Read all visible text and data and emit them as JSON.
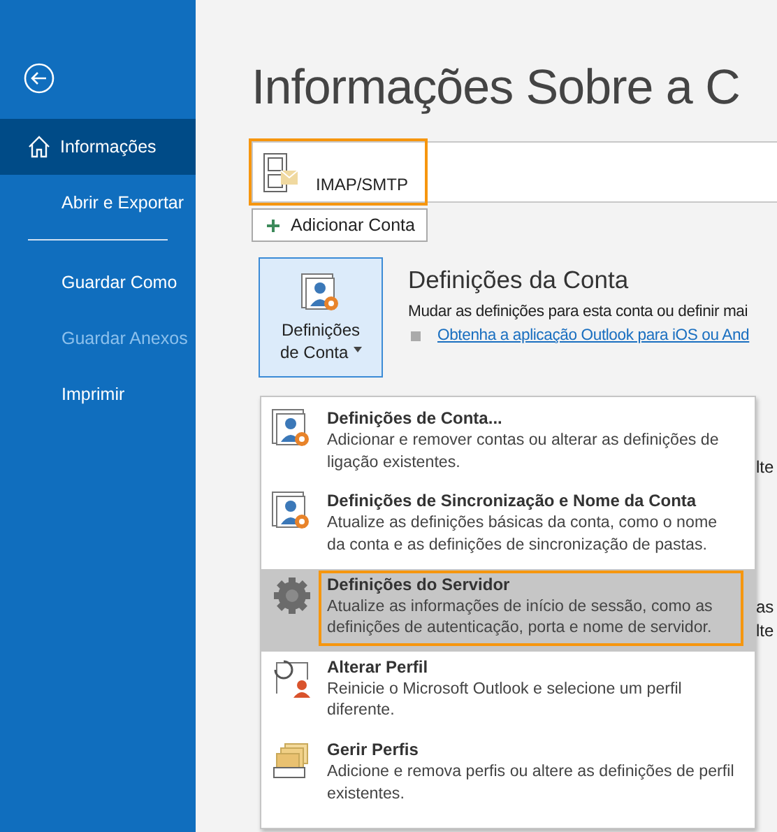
{
  "sidebar": {
    "items": [
      {
        "label": "Informações",
        "kind": "home",
        "selected": true,
        "disabled": false
      },
      {
        "label": "Abrir e Exportar",
        "kind": "plain",
        "selected": false,
        "disabled": false
      },
      {
        "kind": "divider"
      },
      {
        "label": "Guardar Como",
        "kind": "plain",
        "selected": false,
        "disabled": false
      },
      {
        "label": "Guardar Anexos",
        "kind": "plain",
        "selected": false,
        "disabled": true
      },
      {
        "label": "Imprimir",
        "kind": "plain",
        "selected": false,
        "disabled": false
      }
    ]
  },
  "page_title": "Informações Sobre a C",
  "account": {
    "label": "IMAP/SMTP",
    "highlighted": true
  },
  "add_account_button": "Adicionar Conta",
  "account_settings": {
    "button_label_line1": "Definições",
    "button_label_line2": "de Conta",
    "heading": "Definições da Conta",
    "description": "Mudar as definições para esta conta ou definir mai",
    "link": "Obtenha a aplicação Outlook para iOS ou And"
  },
  "background_fragments": [
    "lte",
    "as",
    "lte"
  ],
  "menu": {
    "items": [
      {
        "kind": "person-gear",
        "title": "Definições de Conta...",
        "description": "Adicionar e remover contas ou alterar as definições de ligação existentes.",
        "selected": false,
        "highlighted": false
      },
      {
        "kind": "person-gear",
        "title": "Definições de Sincronização e Nome da Conta",
        "description": "Atualize as definições básicas da conta, como o nome da conta e as definições de sincronização de pastas.",
        "selected": false,
        "highlighted": false
      },
      {
        "kind": "gear",
        "title": "Definições do Servidor",
        "description": "Atualize as informações de início de sessão, como as definições de autenticação, porta e nome de servidor.",
        "selected": true,
        "highlighted": true
      },
      {
        "kind": "profile-switch",
        "title": "Alterar Perfil",
        "description": "Reinicie o Microsoft Outlook e selecione um perfil diferente.",
        "selected": false,
        "highlighted": false
      },
      {
        "kind": "profiles",
        "title": "Gerir Perfis",
        "description": "Adicione e remova perfis ou altere as definições de perfil existentes.",
        "selected": false,
        "highlighted": false
      }
    ]
  }
}
